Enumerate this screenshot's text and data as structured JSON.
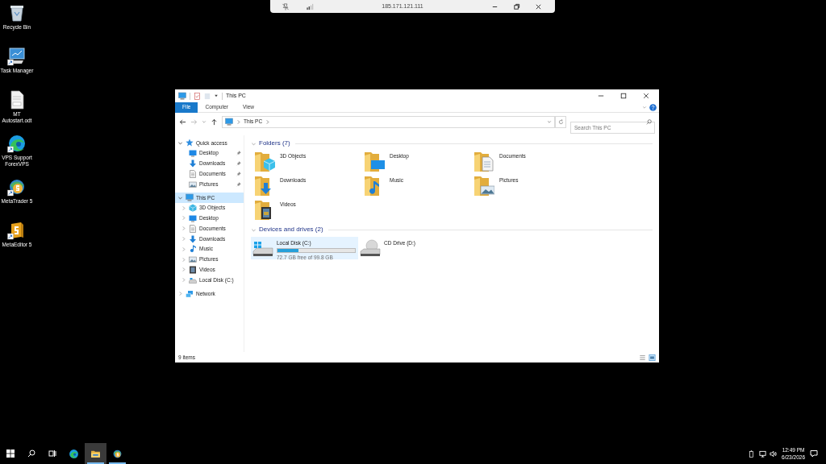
{
  "remote_bar": {
    "address": "185.171.121.111"
  },
  "desktop_icons": [
    {
      "kind": "recycle",
      "label": "Recycle Bin",
      "shortcut": false
    },
    {
      "kind": "taskmgr",
      "label": "Task Manager",
      "shortcut": true
    },
    {
      "kind": "odt",
      "label": "MT Autostart.odt",
      "shortcut": false
    },
    {
      "kind": "edge",
      "label": "VPS Support ForexVPS",
      "shortcut": true
    },
    {
      "kind": "mt5",
      "label": "MetaTrader 5",
      "shortcut": true
    },
    {
      "kind": "me5",
      "label": "MetaEditor 5",
      "shortcut": true
    }
  ],
  "explorer": {
    "title": "This PC",
    "ribbon_tabs": [
      {
        "label": "File",
        "selected": true
      },
      {
        "label": "Computer",
        "selected": false
      },
      {
        "label": "View",
        "selected": false
      }
    ],
    "address": {
      "path": [
        "This PC"
      ]
    },
    "search": {
      "placeholder": "Search This PC"
    },
    "nav_tree": [
      {
        "kind": "star",
        "label": "Quick access",
        "expanded": true,
        "selected": false,
        "children": [
          {
            "kind": "desktop",
            "label": "Desktop",
            "pinned": true
          },
          {
            "kind": "downloads",
            "label": "Downloads",
            "pinned": true
          },
          {
            "kind": "documents",
            "label": "Documents",
            "pinned": true
          },
          {
            "kind": "pictures",
            "label": "Pictures",
            "pinned": true
          }
        ]
      },
      {
        "kind": "pc",
        "label": "This PC",
        "expanded": true,
        "selected": true,
        "children": [
          {
            "kind": "objects3d",
            "label": "3D Objects",
            "expanded": false
          },
          {
            "kind": "desktop",
            "label": "Desktop",
            "expanded": false
          },
          {
            "kind": "documents",
            "label": "Documents",
            "expanded": false
          },
          {
            "kind": "downloads",
            "label": "Downloads",
            "expanded": false
          },
          {
            "kind": "music",
            "label": "Music",
            "expanded": false
          },
          {
            "kind": "pictures",
            "label": "Pictures",
            "expanded": false
          },
          {
            "kind": "videos",
            "label": "Videos",
            "expanded": false
          },
          {
            "kind": "disk",
            "label": "Local Disk (C:)",
            "expanded": false
          }
        ]
      },
      {
        "kind": "network",
        "label": "Network",
        "expanded": false,
        "selected": false
      }
    ],
    "folders": {
      "title": "Folders (7)",
      "items": [
        {
          "kind": "objects3d",
          "label": "3D Objects"
        },
        {
          "kind": "desktop",
          "label": "Desktop"
        },
        {
          "kind": "documents",
          "label": "Documents"
        },
        {
          "kind": "downloads",
          "label": "Downloads"
        },
        {
          "kind": "music",
          "label": "Music"
        },
        {
          "kind": "pictures",
          "label": "Pictures"
        },
        {
          "kind": "videos",
          "label": "Videos"
        }
      ]
    },
    "drives": {
      "title": "Devices and drives (2)",
      "items": [
        {
          "kind": "disk",
          "label": "Local Disk (C:)",
          "level": 0.27,
          "reading": "72.7 GB free of 99.8 GB",
          "selected": true
        },
        {
          "kind": "cd",
          "label": "CD Drive (D:)",
          "selected": false
        }
      ]
    },
    "status": "9 items"
  },
  "taskbar": {
    "apps": [
      {
        "kind": "edge",
        "active": false,
        "running": false
      },
      {
        "kind": "explorer",
        "active": true,
        "running": true
      },
      {
        "kind": "mt5",
        "active": false,
        "running": true
      }
    ],
    "time": "12:49 PM",
    "date": "6/23/2026"
  }
}
